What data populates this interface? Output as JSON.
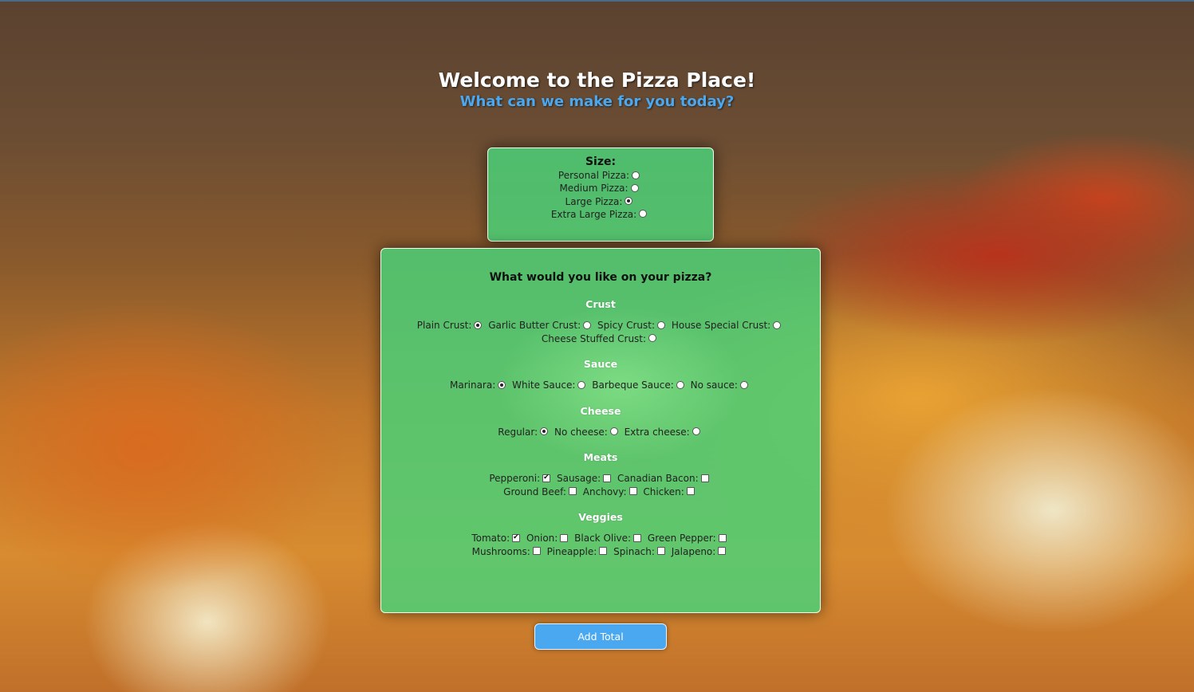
{
  "header": {
    "title": "Welcome to the Pizza Place!",
    "subtitle": "What can we make for you today?"
  },
  "size": {
    "heading": "Size:",
    "options": [
      {
        "label": "Personal Pizza:",
        "selected": false
      },
      {
        "label": "Medium Pizza:",
        "selected": false
      },
      {
        "label": "Large Pizza:",
        "selected": true
      },
      {
        "label": "Extra Large Pizza:",
        "selected": false
      }
    ]
  },
  "toppings": {
    "question": "What would you like on your pizza?",
    "crust": {
      "heading": "Crust",
      "options": [
        {
          "label": "Plain Crust:",
          "selected": true
        },
        {
          "label": "Garlic Butter Crust:",
          "selected": false
        },
        {
          "label": "Spicy Crust:",
          "selected": false
        },
        {
          "label": "House Special Crust:",
          "selected": false
        },
        {
          "label": "Cheese Stuffed Crust:",
          "selected": false
        }
      ]
    },
    "sauce": {
      "heading": "Sauce",
      "options": [
        {
          "label": "Marinara:",
          "selected": true
        },
        {
          "label": "White Sauce:",
          "selected": false
        },
        {
          "label": "Barbeque Sauce:",
          "selected": false
        },
        {
          "label": "No sauce:",
          "selected": false
        }
      ]
    },
    "cheese": {
      "heading": "Cheese",
      "options": [
        {
          "label": "Regular:",
          "selected": true
        },
        {
          "label": "No cheese:",
          "selected": false
        },
        {
          "label": "Extra cheese:",
          "selected": false
        }
      ]
    },
    "meats": {
      "heading": "Meats",
      "options": [
        {
          "label": "Pepperoni:",
          "checked": true
        },
        {
          "label": "Sausage:",
          "checked": false
        },
        {
          "label": "Canadian Bacon:",
          "checked": false
        },
        {
          "label": "Ground Beef:",
          "checked": false
        },
        {
          "label": "Anchovy:",
          "checked": false
        },
        {
          "label": "Chicken:",
          "checked": false
        }
      ]
    },
    "veggies": {
      "heading": "Veggies",
      "options": [
        {
          "label": "Tomato:",
          "checked": true
        },
        {
          "label": "Onion:",
          "checked": false
        },
        {
          "label": "Black Olive:",
          "checked": false
        },
        {
          "label": "Green Pepper:",
          "checked": false
        },
        {
          "label": "Mushrooms:",
          "checked": false
        },
        {
          "label": "Pineapple:",
          "checked": false
        },
        {
          "label": "Spinach:",
          "checked": false
        },
        {
          "label": "Jalapeno:",
          "checked": false
        }
      ]
    }
  },
  "actions": {
    "add_total_label": "Add Total"
  },
  "colors": {
    "panel": "#4ad278",
    "subtitle": "#4aa8f0",
    "button": "#4aa8f0"
  }
}
